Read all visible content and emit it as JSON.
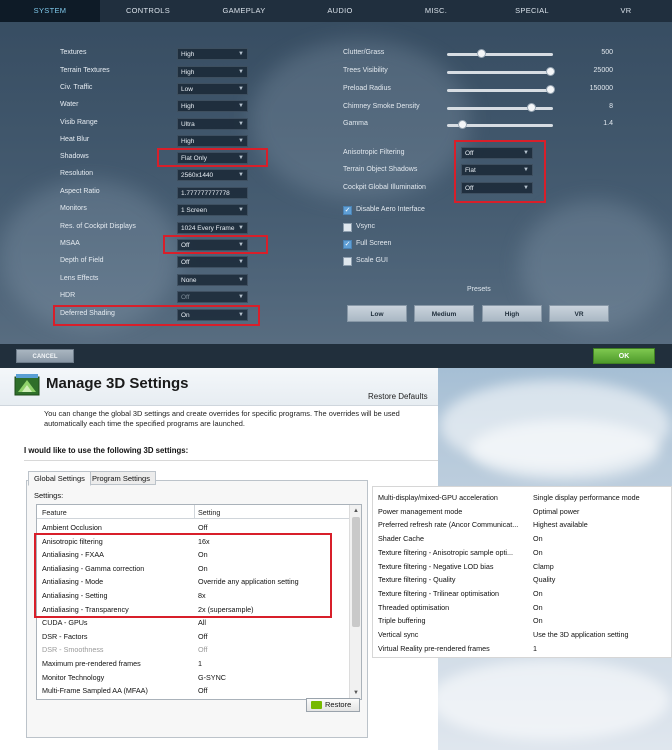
{
  "game": {
    "tabs": [
      "SYSTEM",
      "CONTROLS",
      "GAMEPLAY",
      "AUDIO",
      "MISC.",
      "SPECIAL",
      "VR"
    ],
    "left_settings": [
      {
        "label": "Textures",
        "value": "High"
      },
      {
        "label": "Terrain Textures",
        "value": "High"
      },
      {
        "label": "Civ. Traffic",
        "value": "Low"
      },
      {
        "label": "Water",
        "value": "High"
      },
      {
        "label": "Visib Range",
        "value": "Ultra"
      },
      {
        "label": "Heat Blur",
        "value": "High"
      },
      {
        "label": "Shadows",
        "value": "Flat Only"
      },
      {
        "label": "Resolution",
        "value": "2560x1440"
      },
      {
        "label": "Aspect Ratio",
        "value": "1.777777777778"
      },
      {
        "label": "Monitors",
        "value": "1 Screen"
      },
      {
        "label": "Res. of Cockpit Displays",
        "value": "1024 Every Frame"
      },
      {
        "label": "MSAA",
        "value": "Off"
      },
      {
        "label": "Depth of Field",
        "value": "Off"
      },
      {
        "label": "Lens Effects",
        "value": "None"
      },
      {
        "label": "HDR",
        "value": "Off"
      },
      {
        "label": "Deferred Shading",
        "value": "On"
      }
    ],
    "sliders": [
      {
        "label": "Clutter/Grass",
        "value": "500",
        "level": 0.33
      },
      {
        "label": "Trees Visibility",
        "value": "25000",
        "level": 0.98
      },
      {
        "label": "Preload Radius",
        "value": "150000",
        "level": 0.98
      },
      {
        "label": "Chimney Smoke Density",
        "value": "8",
        "level": 0.8
      },
      {
        "label": "Gamma",
        "value": "1.4",
        "level": 0.15
      }
    ],
    "right_settings": [
      {
        "label": "Anisotropic Filtering",
        "value": "Off"
      },
      {
        "label": "Terrain Object Shadows",
        "value": "Flat"
      },
      {
        "label": "Cockpit Global Illumination",
        "value": "Off"
      }
    ],
    "checkboxes": [
      {
        "label": "Disable Aero Interface",
        "checked": "yes"
      },
      {
        "label": "Vsync",
        "checked": "no"
      },
      {
        "label": "Full Screen",
        "checked": "yes"
      },
      {
        "label": "Scale GUI",
        "checked": "no"
      }
    ],
    "presets_label": "Presets",
    "presets": [
      "Low",
      "Medium",
      "High",
      "VR"
    ],
    "cancel": "CANCEL",
    "ok": "OK"
  },
  "nv": {
    "title": "Manage 3D Settings",
    "restore_defaults": "Restore Defaults",
    "description": "You can change the global 3D settings and create overrides for specific programs. The overrides will be used automatically each time the specified programs are launched.",
    "heading": "I would like to use the following 3D settings:",
    "tabs": [
      "Global Settings",
      "Program Settings"
    ],
    "settings_label": "Settings:",
    "columns": [
      "Feature",
      "Setting"
    ],
    "rows": [
      {
        "feature": "Ambient Occlusion",
        "setting": "Off"
      },
      {
        "feature": "Anisotropic filtering",
        "setting": "16x"
      },
      {
        "feature": "Antialiasing - FXAA",
        "setting": "On"
      },
      {
        "feature": "Antialiasing - Gamma correction",
        "setting": "On"
      },
      {
        "feature": "Antialiasing - Mode",
        "setting": "Override any application setting"
      },
      {
        "feature": "Antialiasing - Setting",
        "setting": "8x"
      },
      {
        "feature": "Antialiasing - Transparency",
        "setting": "2x (supersample)"
      },
      {
        "feature": "CUDA - GPUs",
        "setting": "All"
      },
      {
        "feature": "DSR - Factors",
        "setting": "Off"
      },
      {
        "feature": "DSR - Smoothness",
        "setting": "Off"
      },
      {
        "feature": "Maximum pre-rendered frames",
        "setting": "1"
      },
      {
        "feature": "Monitor Technology",
        "setting": "G-SYNC"
      },
      {
        "feature": "Multi-Frame Sampled AA (MFAA)",
        "setting": "Off"
      }
    ],
    "restore_button": "Restore"
  },
  "extra": {
    "rows": [
      {
        "feature": "Multi-display/mixed-GPU acceleration",
        "setting": "Single display performance mode"
      },
      {
        "feature": "Power management mode",
        "setting": "Optimal power"
      },
      {
        "feature": "Preferred refresh rate (Ancor Communicat...",
        "setting": "Highest available"
      },
      {
        "feature": "Shader Cache",
        "setting": "On"
      },
      {
        "feature": "Texture filtering - Anisotropic sample opti...",
        "setting": "On"
      },
      {
        "feature": "Texture filtering - Negative LOD bias",
        "setting": "Clamp"
      },
      {
        "feature": "Texture filtering - Quality",
        "setting": "Quality"
      },
      {
        "feature": "Texture filtering - Trilinear optimisation",
        "setting": "On"
      },
      {
        "feature": "Threaded optimisation",
        "setting": "On"
      },
      {
        "feature": "Triple buffering",
        "setting": "On"
      },
      {
        "feature": "Vertical sync",
        "setting": "Use the 3D application setting"
      },
      {
        "feature": "Virtual Reality pre-rendered frames",
        "setting": "1"
      }
    ]
  },
  "colors": {
    "highlight": "#d81f2a",
    "active_tab_text": "#7fc8ea",
    "ok_green": "#4e9a2b",
    "nvidia_green": "#76b900"
  }
}
